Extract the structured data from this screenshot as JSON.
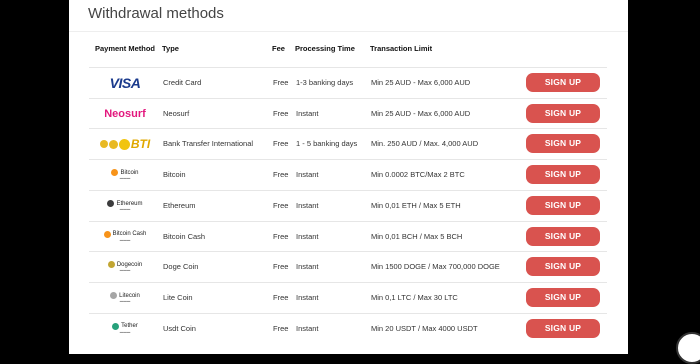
{
  "page": {
    "title": "Withdrawal methods"
  },
  "colors": {
    "accent": "#d9534f",
    "background": "#000000"
  },
  "table": {
    "headers": {
      "method": "Payment Method",
      "type": "Type",
      "fee": "Fee",
      "processing": "Processing Time",
      "limit": "Transaction Limit"
    },
    "rows": [
      {
        "logo": "VISA",
        "logo_icon": "visa-logo",
        "type": "Credit Card",
        "fee": "Free",
        "processing": "1-3 banking days",
        "limit": "Min 25 AUD - Max 6,000 AUD",
        "button": "SIGN UP"
      },
      {
        "logo": "Neosurf",
        "logo_icon": "neosurf-logo",
        "type": "Neosurf",
        "fee": "Free",
        "processing": "Instant",
        "limit": "Min 25 AUD - Max 6,000 AUD",
        "button": "SIGN UP"
      },
      {
        "logo": "BTI",
        "logo_icon": "bti-logo",
        "type": "Bank Transfer International",
        "fee": "Free",
        "processing": "1 - 5 banking days",
        "limit": "Min. 250 AUD / Max. 4,000 AUD",
        "button": "SIGN UP"
      },
      {
        "logo": "Bitcoin",
        "logo_icon": "bitcoin-logo",
        "type": "Bitcoin",
        "fee": "Free",
        "processing": "Instant",
        "limit": "Min 0.0002 BTC/Max 2 BTC",
        "button": "SIGN UP"
      },
      {
        "logo": "Ethereum",
        "logo_icon": "ethereum-logo",
        "type": "Ethereum",
        "fee": "Free",
        "processing": "Instant",
        "limit": "Min 0,01 ETH / Max 5 ETH",
        "button": "SIGN UP"
      },
      {
        "logo": "Bitcoin Cash",
        "logo_icon": "bitcoin-cash-logo",
        "type": "Bitcoin Cash",
        "fee": "Free",
        "processing": "Instant",
        "limit": "Min 0,01 BCH / Max 5 BCH",
        "button": "SIGN UP"
      },
      {
        "logo": "Dogecoin",
        "logo_icon": "dogecoin-logo",
        "type": "Doge Coin",
        "fee": "Free",
        "processing": "Instant",
        "limit": "Min 1500 DOGE / Max 700,000 DOGE",
        "button": "SIGN UP"
      },
      {
        "logo": "Litecoin",
        "logo_icon": "litecoin-logo",
        "type": "Lite Coin",
        "fee": "Free",
        "processing": "Instant",
        "limit": "Min 0,1 LTC / Max 30 LTC",
        "button": "SIGN UP"
      },
      {
        "logo": "Tether",
        "logo_icon": "tether-logo",
        "type": "Usdt Coin",
        "fee": "Free",
        "processing": "Instant",
        "limit": "Min 20 USDT / Max 4000 USDT",
        "button": "SIGN UP"
      }
    ]
  }
}
